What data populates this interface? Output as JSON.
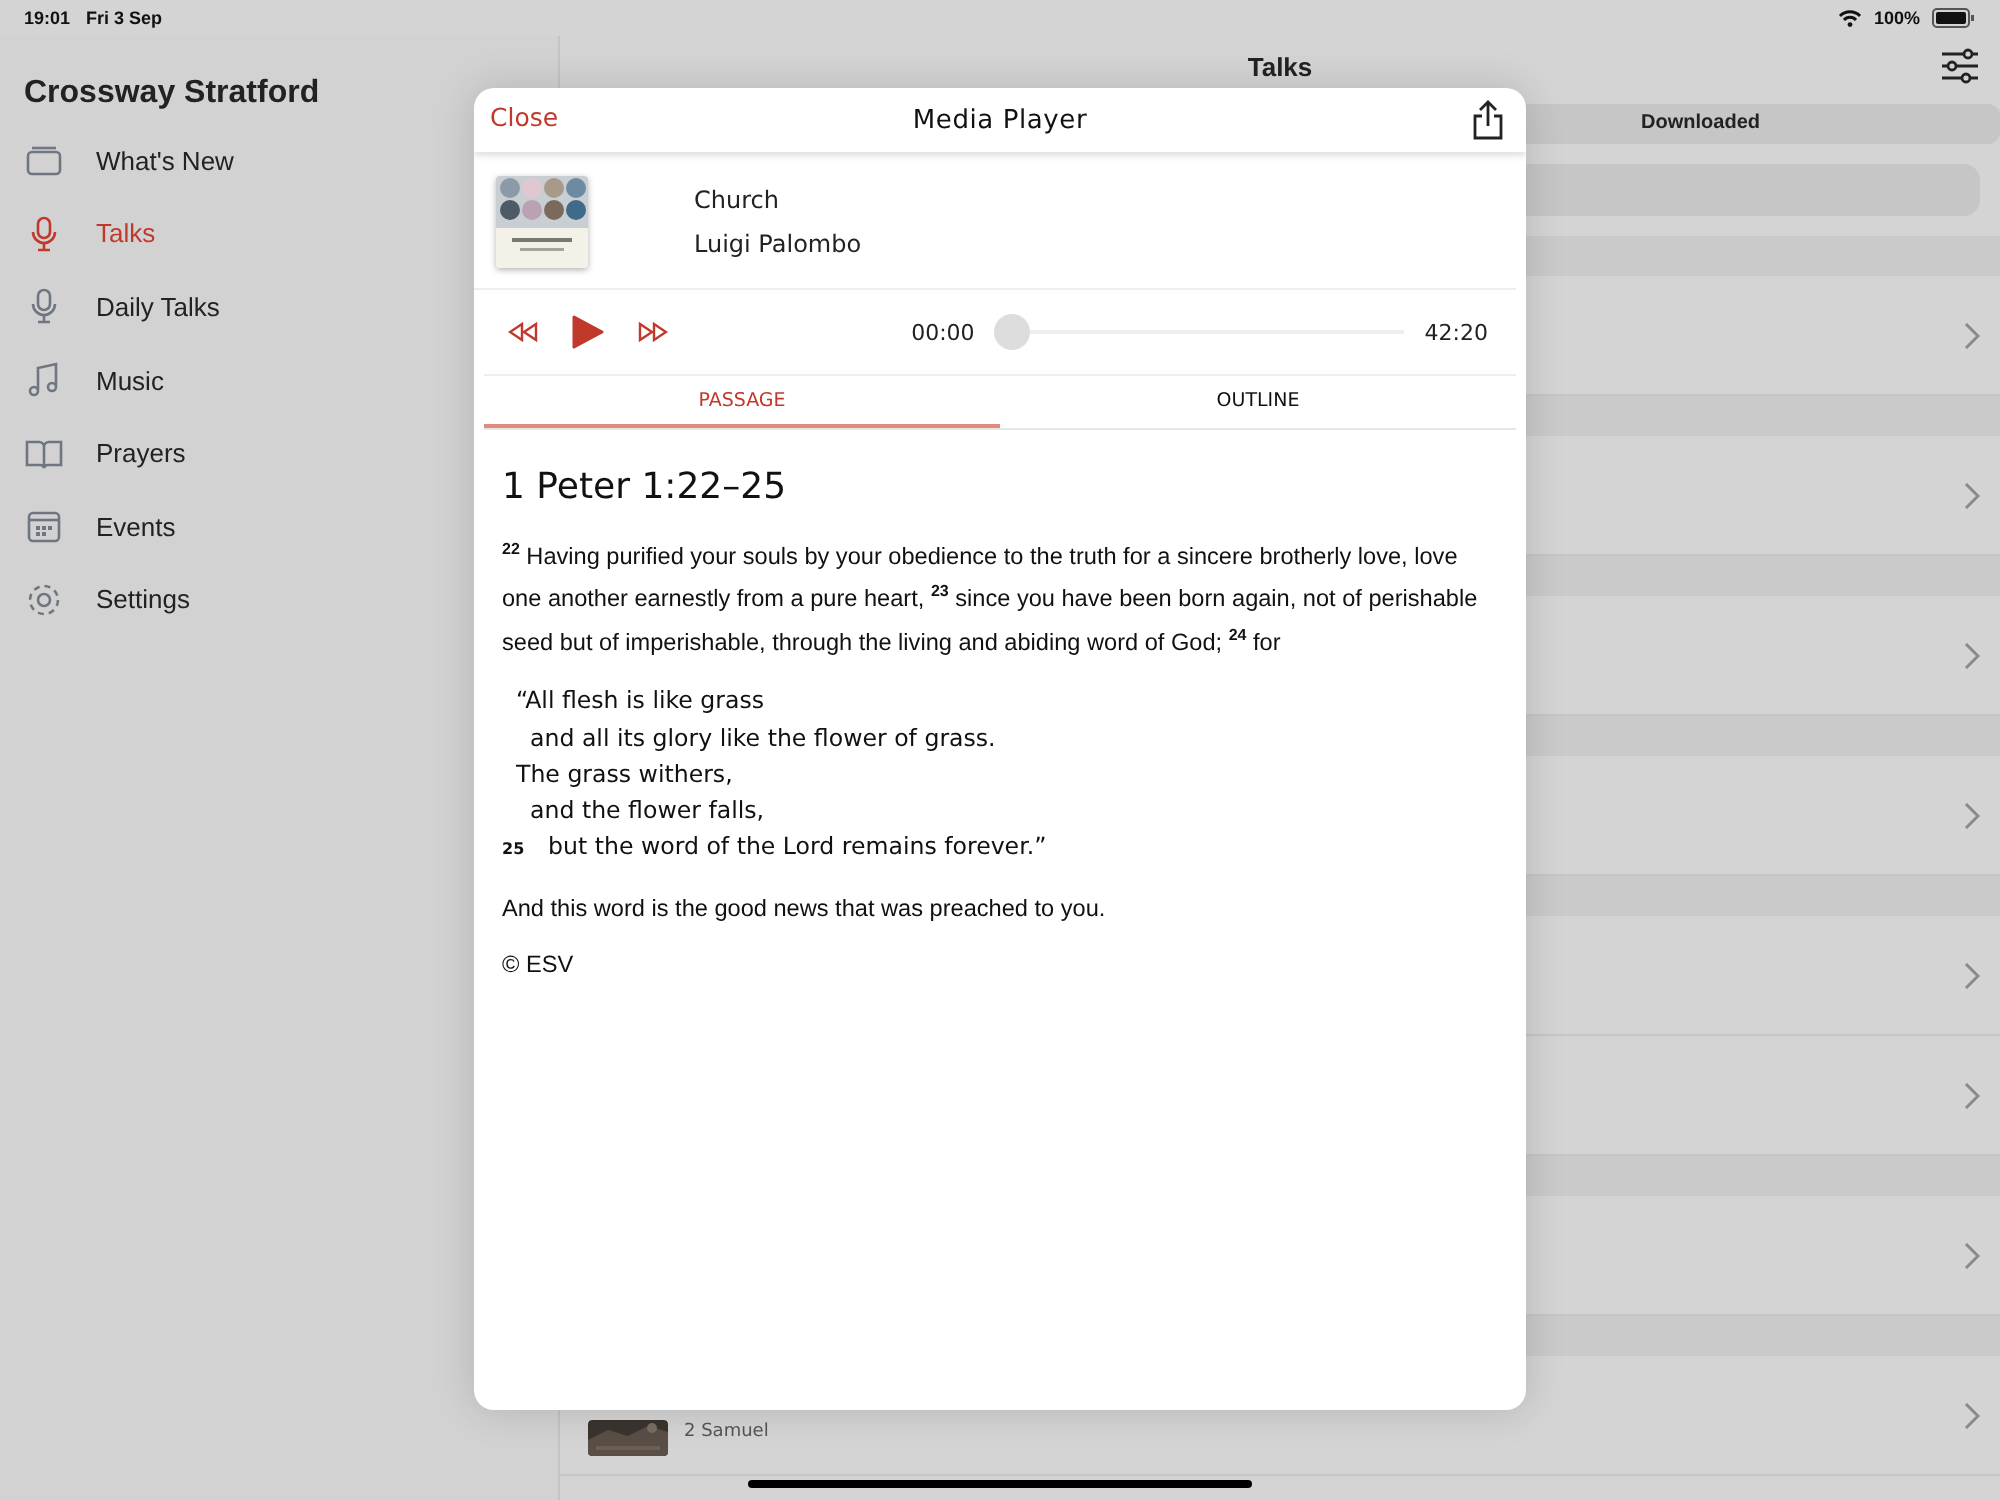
{
  "status_bar": {
    "time": "19:01",
    "date": "Fri 3 Sep",
    "battery": "100%"
  },
  "sidebar": {
    "title": "Crossway Stratford",
    "items": [
      {
        "label": "What's New",
        "kind": "tray",
        "selected": false
      },
      {
        "label": "Talks",
        "kind": "mic",
        "selected": true
      },
      {
        "label": "Daily Talks",
        "kind": "mic",
        "selected": false
      },
      {
        "label": "Music",
        "kind": "note",
        "selected": false
      },
      {
        "label": "Prayers",
        "kind": "book",
        "selected": false
      },
      {
        "label": "Events",
        "kind": "calendar",
        "selected": false
      },
      {
        "label": "Settings",
        "kind": "gear",
        "selected": false
      }
    ]
  },
  "talks": {
    "title": "Talks",
    "segments": [
      {
        "label": "Downloaded",
        "selected": false
      }
    ],
    "rows": [
      {
        "section_header": true
      },
      {
        "section_header": true
      },
      {
        "section_header": true
      },
      {
        "section_header": true
      },
      {
        "section_header": true
      },
      {
        "section_header": false
      },
      {
        "section_header": true
      },
      {
        "section_header": true,
        "subtitle": "2 Samuel",
        "kind": "picture"
      }
    ]
  },
  "media_player": {
    "close": "Close",
    "title": "Media Player",
    "track": {
      "title": "Church",
      "speaker": "Luigi Palombo"
    },
    "player": {
      "elapsed": "00:00",
      "duration": "42:20",
      "level": 0
    },
    "tabs": [
      {
        "label": "PASSAGE",
        "selected": true
      },
      {
        "label": "OUTLINE",
        "selected": false
      }
    ],
    "passage": {
      "heading": "1 Peter 1:22–25",
      "intro": "$^{22}$ Having purified your souls by your obedience to the truth for a sincere brotherly love, love one another earnestly from a pure heart, $^{23}$ since you have been born again, not of perishable seed but of imperishable, through the living and abiding word of God; $^{24}$ for",
      "poetry": [
        {
          "text": "“All flesh is like grass",
          "indent": false
        },
        {
          "text": "and all its glory like the flower of grass.",
          "indent": true
        },
        {
          "text": "The grass withers,",
          "indent": false
        },
        {
          "text": "and the flower falls,",
          "indent": true
        },
        {
          "text": "but the word of the Lord remains forever.”",
          "indent": true,
          "verse": "25"
        }
      ],
      "closing": "And this word is the good news that was preached to you.",
      "copyright": "© ESV"
    }
  }
}
